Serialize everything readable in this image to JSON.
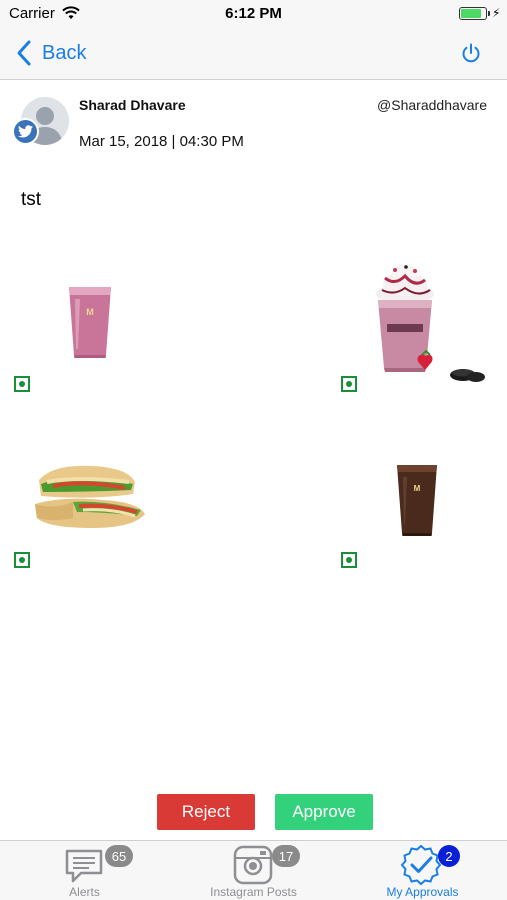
{
  "status_bar": {
    "carrier": "Carrier",
    "time": "6:12 PM"
  },
  "nav": {
    "back_label": "Back",
    "accent_color": "#1a7ee6"
  },
  "post": {
    "author_name": "Sharad Dhavare",
    "handle": "@Sharaddhavare",
    "date": "Mar 15, 2018 | 04:30 PM",
    "text": "tst",
    "network_icon": "twitter-icon"
  },
  "products": [
    {
      "name": "pink-smoothie",
      "veg": true
    },
    {
      "name": "berry-shake",
      "veg": true
    },
    {
      "name": "wrap",
      "veg": true
    },
    {
      "name": "chocolate-shake",
      "veg": true
    }
  ],
  "actions": {
    "reject_label": "Reject",
    "approve_label": "Approve",
    "reject_color": "#d93a36",
    "approve_color": "#34d17c"
  },
  "tab_bar": {
    "tabs": [
      {
        "label": "Alerts",
        "badge": "65",
        "icon": "alerts-icon",
        "active": false
      },
      {
        "label": "Instagram Posts",
        "badge": "17",
        "icon": "instagram-icon",
        "active": false
      },
      {
        "label": "My Approvals",
        "badge": "2",
        "icon": "approvals-icon",
        "active": true
      }
    ]
  }
}
